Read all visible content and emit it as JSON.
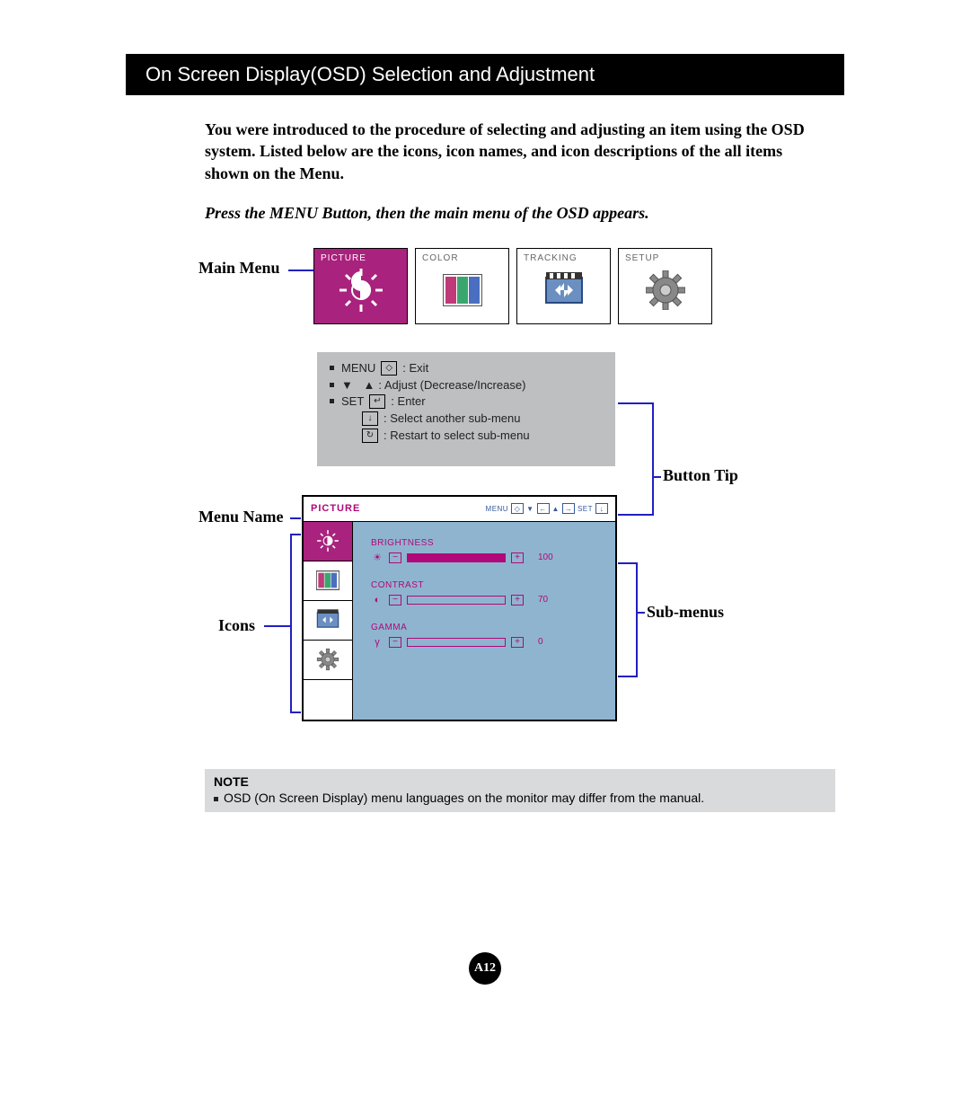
{
  "title": "On Screen Display(OSD) Selection and Adjustment",
  "intro": "You were introduced to the procedure of selecting and adjusting an item using the OSD system.  Listed below are the icons, icon names, and icon descriptions of the all items shown on the Menu.",
  "press": "Press the MENU Button, then the main menu of the OSD appears.",
  "labels": {
    "main_menu": "Main Menu",
    "menu_name": "Menu Name",
    "icons": "Icons",
    "button_tip": "Button Tip",
    "sub_menus": "Sub-menus"
  },
  "tabs": [
    {
      "label": "PICTURE",
      "icon": "brightness",
      "active": true
    },
    {
      "label": "COLOR",
      "icon": "color",
      "active": false
    },
    {
      "label": "TRACKING",
      "icon": "tracking",
      "active": false
    },
    {
      "label": "SETUP",
      "icon": "gear",
      "active": false
    }
  ],
  "tips": {
    "menu_label": "MENU",
    "menu_action": ": Exit",
    "adjust": ": Adjust (Decrease/Increase)",
    "set_label": "SET",
    "set_action": ": Enter",
    "select_another": ": Select another sub-menu",
    "restart": ": Restart to select sub-menu"
  },
  "osd": {
    "menu_name": "PICTURE",
    "head_nav": {
      "menu": "MENU",
      "set": "SET"
    },
    "icons": [
      "brightness",
      "color",
      "tracking",
      "gear"
    ],
    "settings": [
      {
        "name": "BRIGHTNESS",
        "icon": "sun",
        "value": 100,
        "fill": 100
      },
      {
        "name": "CONTRAST",
        "icon": "contrast",
        "value": 70,
        "fill": 0
      },
      {
        "name": "GAMMA",
        "icon": "gamma",
        "value": 0,
        "fill": 0
      }
    ]
  },
  "note": {
    "title": "NOTE",
    "text": "OSD (On Screen Display) menu languages on the monitor may differ from the manual."
  },
  "page_number": "A12"
}
